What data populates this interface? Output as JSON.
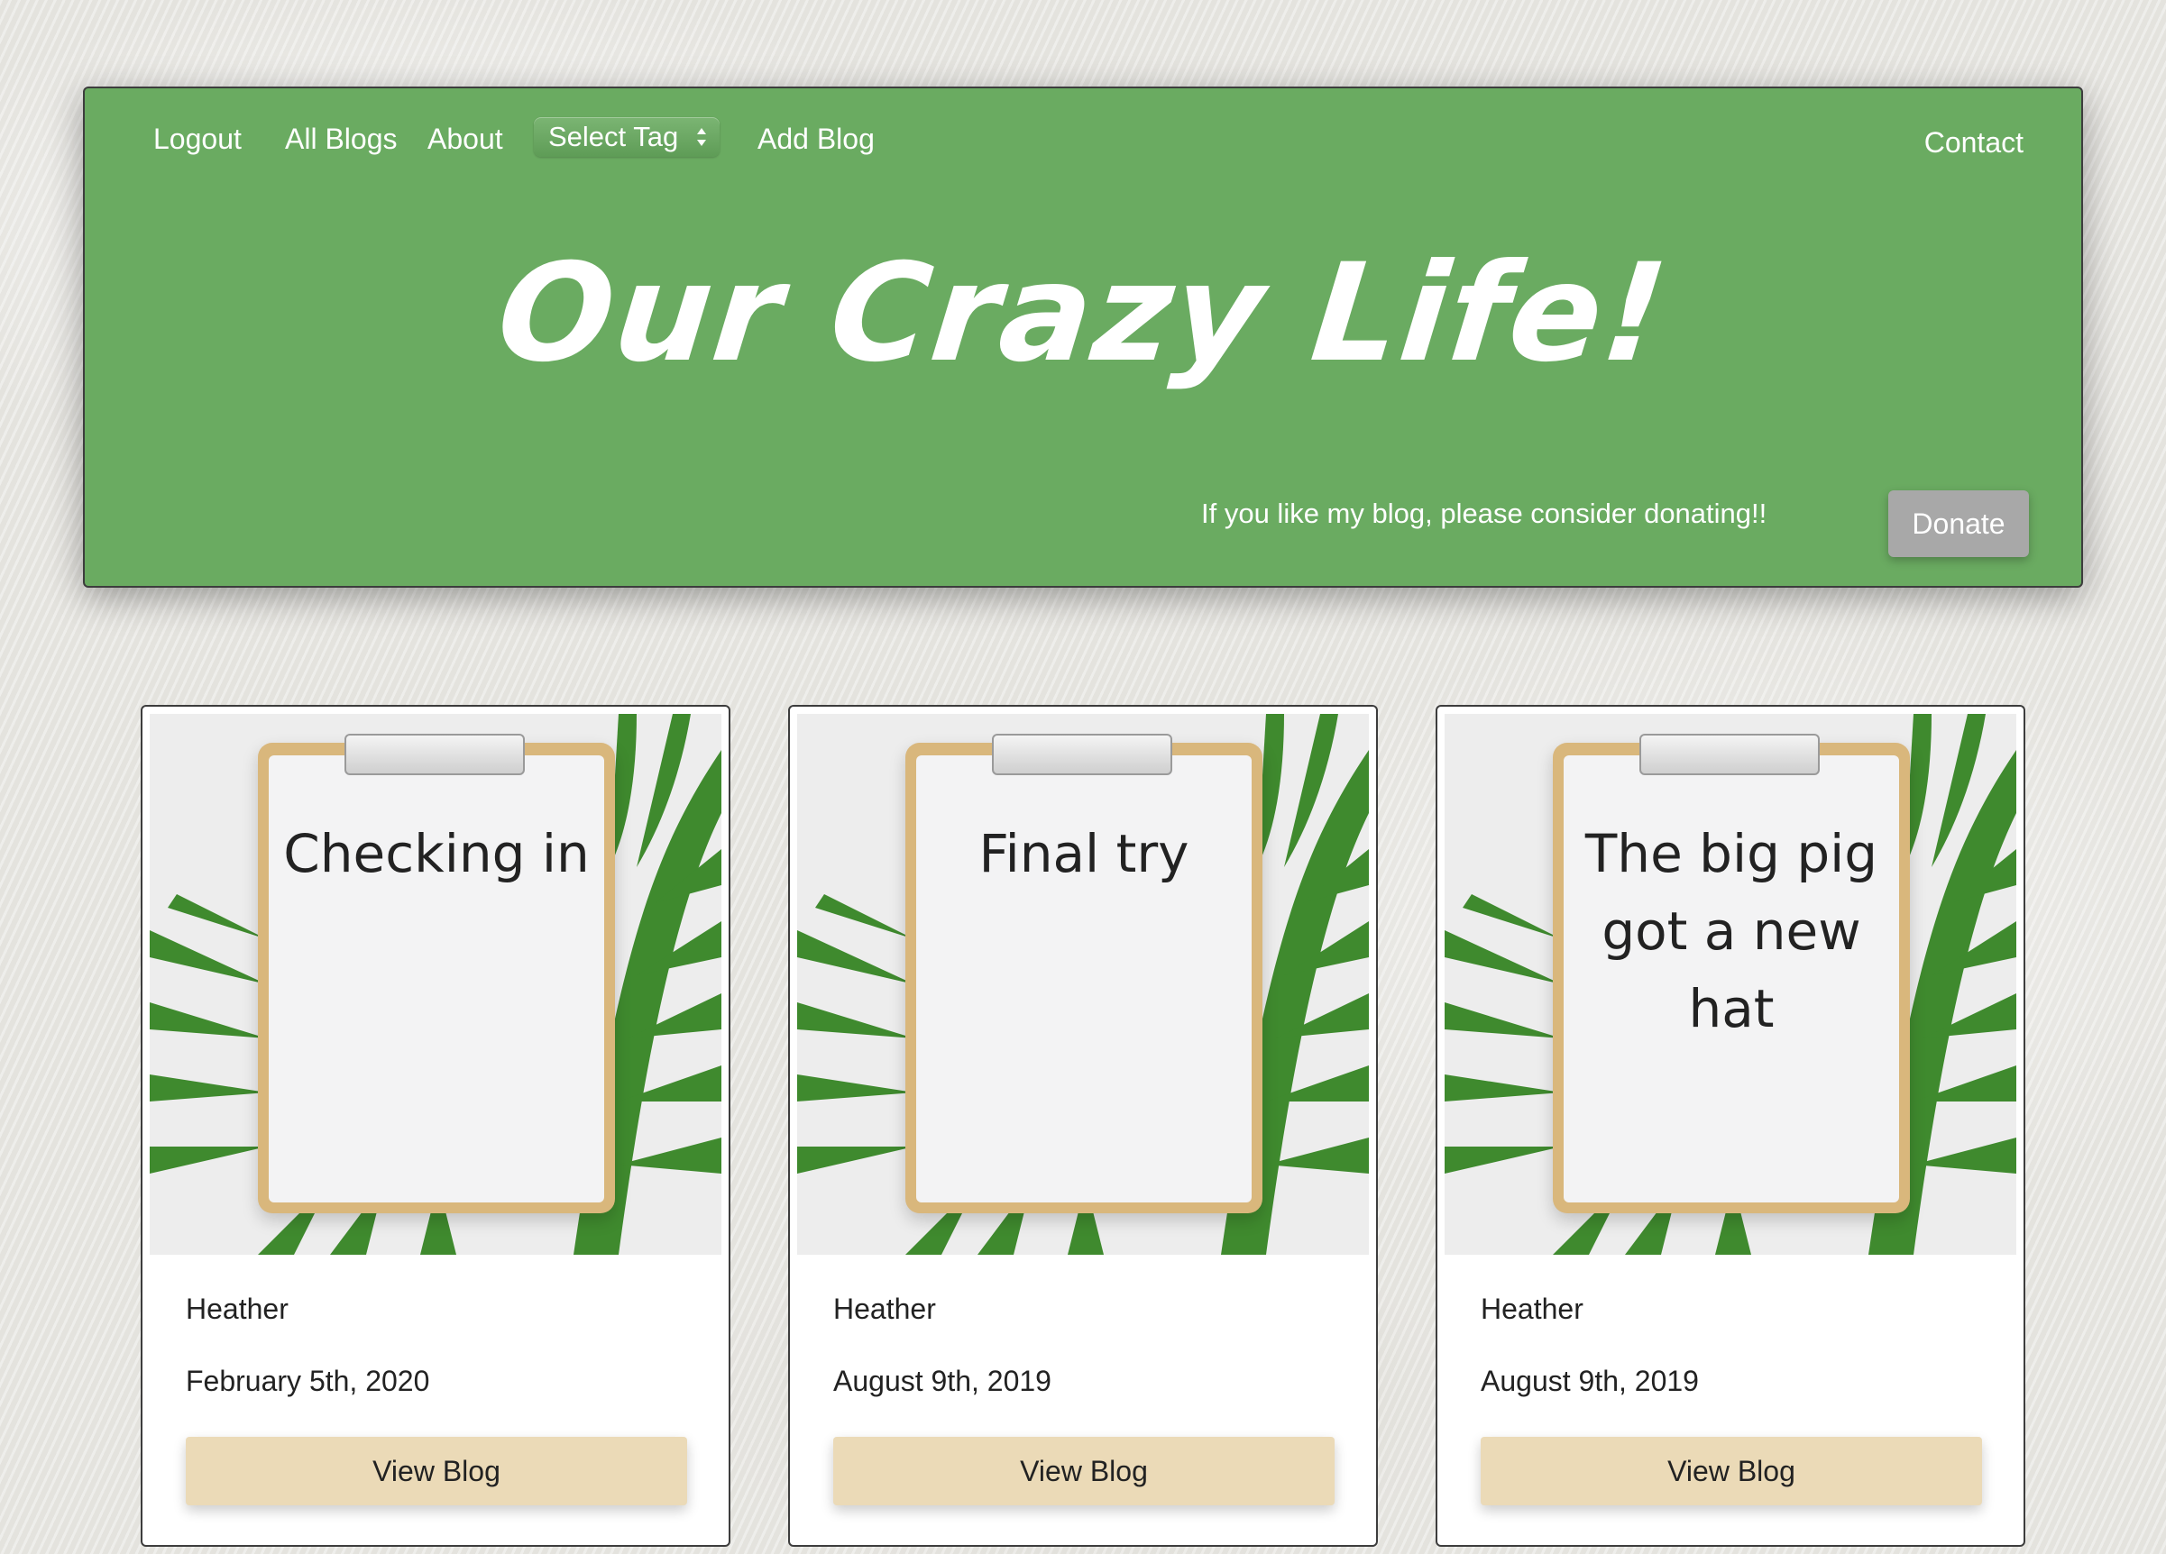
{
  "nav": {
    "logout": "Logout",
    "all_blogs": "All Blogs",
    "about": "About",
    "select_tag": "Select Tag",
    "add_blog": "Add Blog",
    "contact": "Contact"
  },
  "header": {
    "title": "Our Crazy Life!",
    "donate_text": "If you like my blog, please consider donating!!",
    "donate_button": "Donate"
  },
  "colors": {
    "header_green": "#6aab61",
    "donate_gray": "#a8a8a8",
    "view_button_tan": "#ebdab7"
  },
  "blogs": [
    {
      "title": "Checking in",
      "author": "Heather",
      "date": "February 5th, 2020",
      "button": "View Blog"
    },
    {
      "title": "Final try",
      "author": "Heather",
      "date": "August 9th, 2019",
      "button": "View Blog"
    },
    {
      "title": "The big pig got a new hat",
      "author": "Heather",
      "date": "August 9th, 2019",
      "button": "View Blog"
    }
  ]
}
